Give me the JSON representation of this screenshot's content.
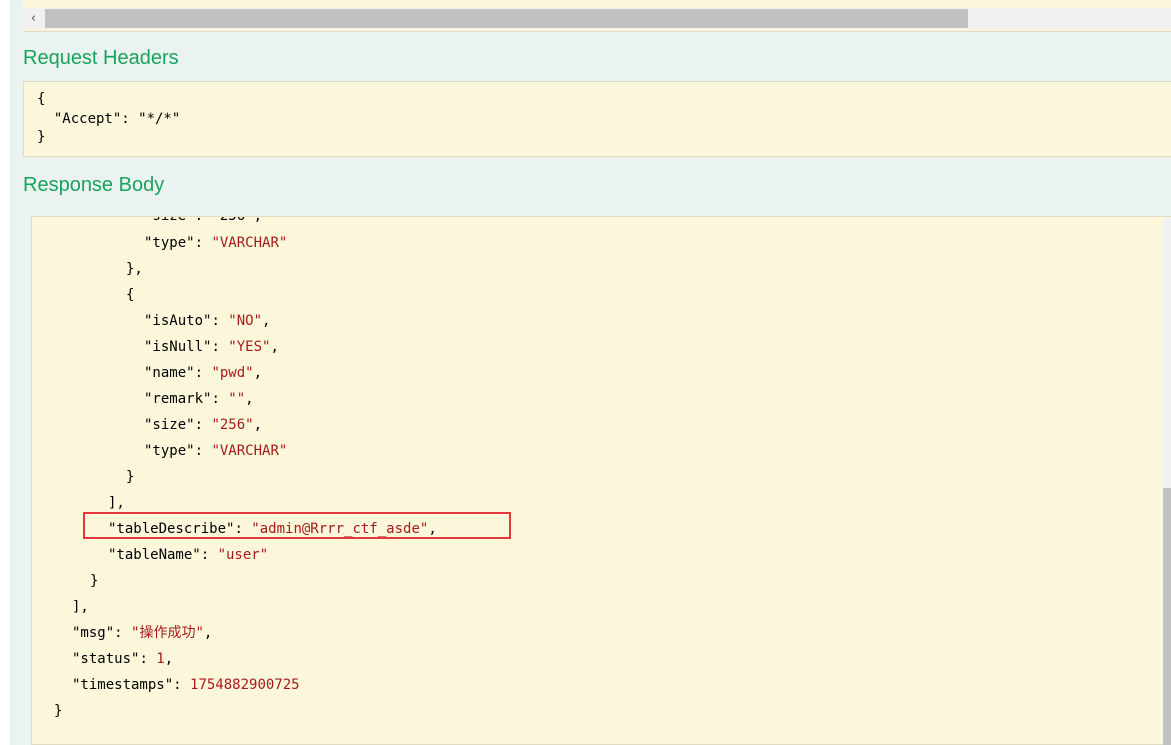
{
  "top_scrollbar": {
    "left_arrow": "‹"
  },
  "request_headers": {
    "title": "Request Headers",
    "lines": [
      "{",
      "  \"Accept\": \"*/*\"",
      "}"
    ]
  },
  "response_body": {
    "title": "Response Body",
    "partial_top": "\"size\": \"256\",",
    "l1_key": "\"type\"",
    "l1_val": "\"VARCHAR\"",
    "l2": "},",
    "l3": "{",
    "l4_key": "\"isAuto\"",
    "l4_val": "\"NO\"",
    "l5_key": "\"isNull\"",
    "l5_val": "\"YES\"",
    "l6_key": "\"name\"",
    "l6_val": "\"pwd\"",
    "l7_key": "\"remark\"",
    "l7_val": "\"\"",
    "l8_key": "\"size\"",
    "l8_val": "\"256\"",
    "l9_key": "\"type\"",
    "l9_val": "\"VARCHAR\"",
    "l10": "}",
    "l11": "],",
    "l12_key": "\"tableDescribe\"",
    "l12_val": "\"admin@Rrrr_ctf_asde\"",
    "l13_key": "\"tableName\"",
    "l13_val": "\"user\"",
    "l14": "}",
    "l15": "],",
    "l16_key": "\"msg\"",
    "l16_val": "\"操作成功\"",
    "l17_key": "\"status\"",
    "l17_val": "1",
    "l18_key": "\"timestamps\"",
    "l18_val": "1754882900725",
    "l19": "}"
  }
}
